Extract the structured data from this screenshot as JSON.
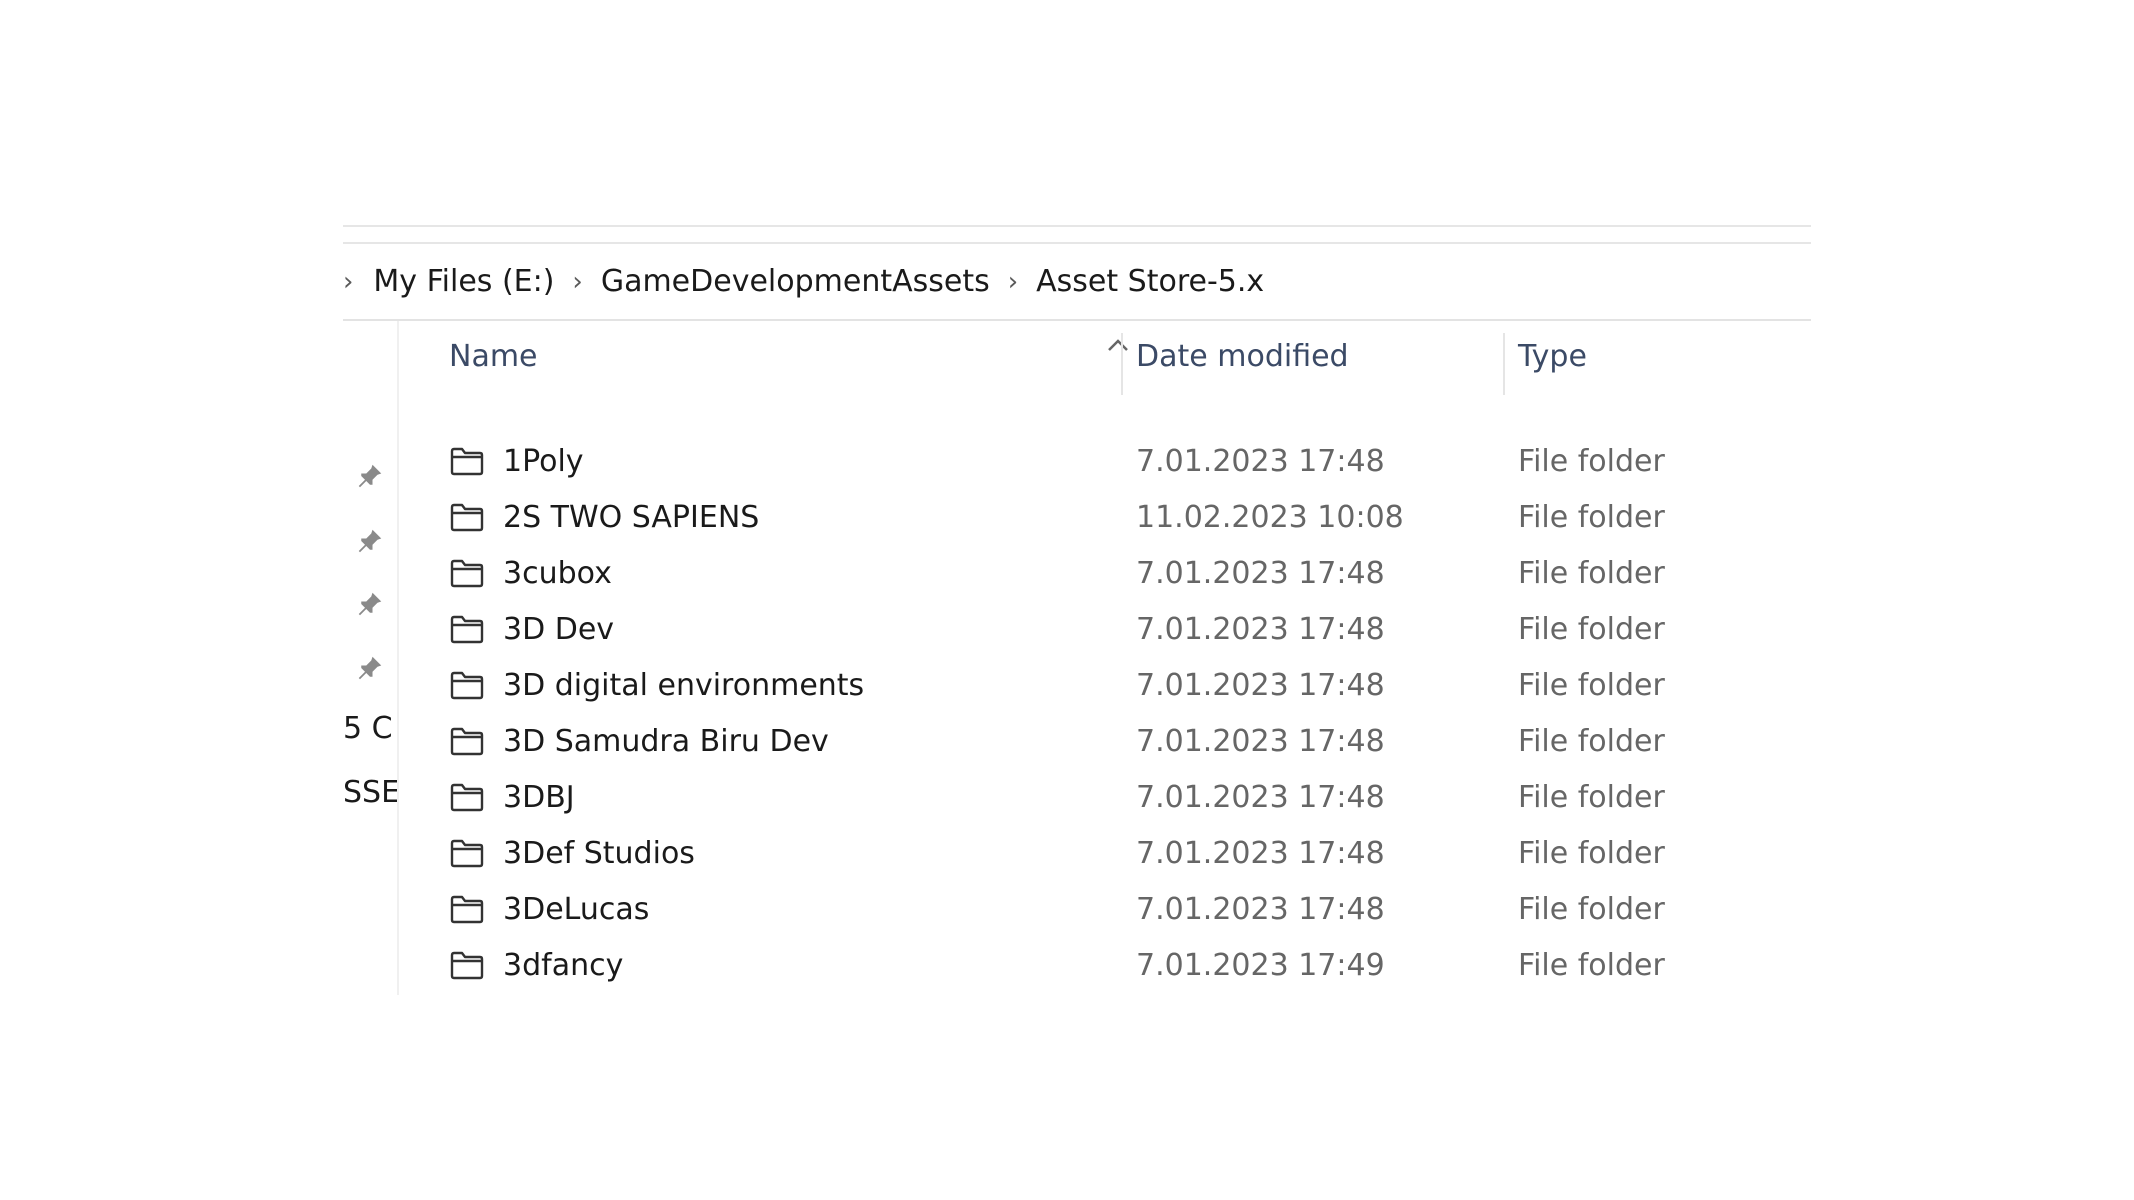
{
  "breadcrumb": {
    "items": [
      "My Files (E:)",
      "GameDevelopmentAssets",
      "Asset Store-5.x"
    ]
  },
  "nav_pane": {
    "partial_labels": [
      "5 C",
      "SSE"
    ]
  },
  "columns": {
    "name": "Name",
    "date": "Date modified",
    "type": "Type"
  },
  "rows": [
    {
      "name": "1Poly",
      "date": "7.01.2023 17:48",
      "type": "File folder"
    },
    {
      "name": "2S TWO SAPIENS",
      "date": "11.02.2023 10:08",
      "type": "File folder"
    },
    {
      "name": "3cubox",
      "date": "7.01.2023 17:48",
      "type": "File folder"
    },
    {
      "name": "3D Dev",
      "date": "7.01.2023 17:48",
      "type": "File folder"
    },
    {
      "name": "3D digital environments",
      "date": "7.01.2023 17:48",
      "type": "File folder"
    },
    {
      "name": "3D Samudra Biru Dev",
      "date": "7.01.2023 17:48",
      "type": "File folder"
    },
    {
      "name": "3DBJ",
      "date": "7.01.2023 17:48",
      "type": "File folder"
    },
    {
      "name": "3Def Studios",
      "date": "7.01.2023 17:48",
      "type": "File folder"
    },
    {
      "name": "3DeLucas",
      "date": "7.01.2023 17:48",
      "type": "File folder"
    },
    {
      "name": "3dfancy",
      "date": "7.01.2023 17:49",
      "type": "File folder"
    }
  ],
  "icons": {
    "row_icon": "folder-icon",
    "pin_icon": "pin-icon",
    "sort_icon": "sort-ascending-icon",
    "separator_icon": "chevron-right-icon"
  }
}
